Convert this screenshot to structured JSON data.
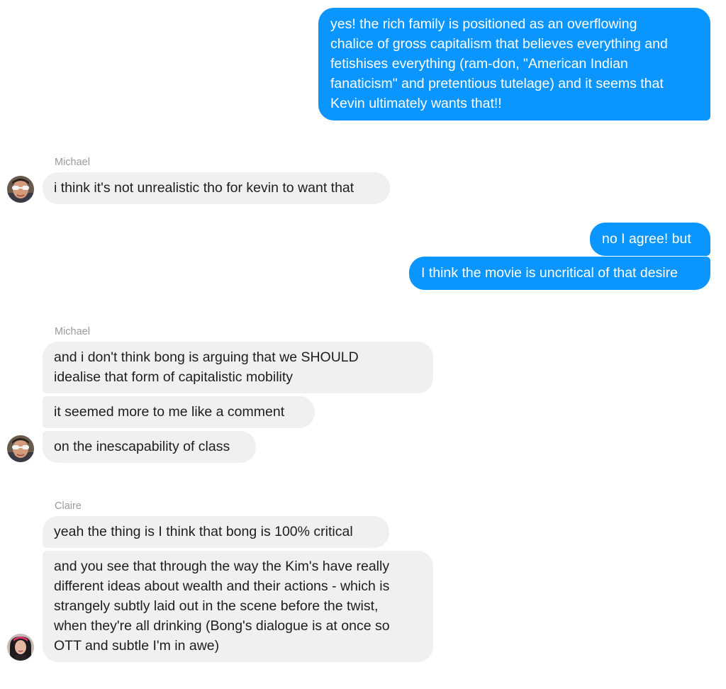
{
  "conversation": {
    "messages": [
      {
        "text": "yes! the rich family is positioned as an overflowing\nchalice of gross capitalism that believes everything and\nfetishises everything (ram-don, \"American Indian\nfanaticism\" and pretentious tutelage) and it seems that\nKevin ultimately wants that!!"
      },
      {
        "text": "i think it's not unrealistic tho for kevin to want that"
      },
      {
        "text": "no I agree! but"
      },
      {
        "text": "I think the movie is uncritical of that desire"
      },
      {
        "text": "and i don't think bong is arguing that we SHOULD\nidealise that form of capitalistic mobility"
      },
      {
        "text": "it seemed more to me like a comment"
      },
      {
        "text": "on the inescapability of class"
      },
      {
        "text": "yeah the thing is I think that bong is 100% critical"
      },
      {
        "text": "and you see that through the way the Kim's have really\ndifferent ideas about wealth and their actions - which is\nstrangely subtly laid out in the scene before the twist,\nwhen they're all drinking (Bong's dialogue is at once so\nOTT and subtle I'm in awe)"
      }
    ],
    "senders": [
      {
        "name": "Michael"
      },
      {
        "name": "Michael"
      },
      {
        "name": "Claire"
      }
    ]
  },
  "colors": {
    "outgoing_bubble": "#0a95ff",
    "incoming_bubble": "#f1f0f0",
    "sender_name": "#9a9a9a"
  },
  "icons": {
    "michael_avatar": "avatar-michael-icon",
    "claire_avatar": "avatar-claire-icon"
  }
}
